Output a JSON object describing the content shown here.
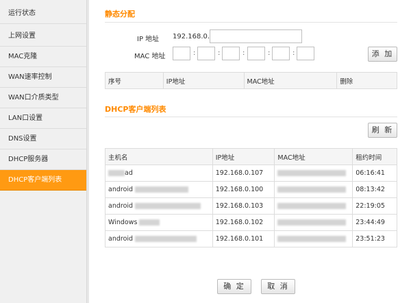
{
  "sidebar": {
    "items": [
      {
        "label": "运行状态"
      },
      {
        "label": "上网设置"
      },
      {
        "label": "MAC克隆"
      },
      {
        "label": "WAN速率控制"
      },
      {
        "label": "WAN口介质类型"
      },
      {
        "label": "LAN口设置"
      },
      {
        "label": "DNS设置"
      },
      {
        "label": "DHCP服务器"
      },
      {
        "label": "DHCP客户端列表"
      }
    ],
    "active_index": 8
  },
  "static": {
    "title": "静态分配",
    "ip_label": "IP 地址",
    "ip_prefix": "192.168.0.",
    "ip_value": "",
    "mac_label": "MAC 地址",
    "mac_sep": ":",
    "add_button": "添 加",
    "table": {
      "headers": [
        "序号",
        "IP地址",
        "MAC地址",
        "删除"
      ]
    }
  },
  "clients": {
    "title": "DHCP客户端列表",
    "refresh_button": "刷 新",
    "headers": [
      "主机名",
      "IP地址",
      "MAC地址",
      "租约时间"
    ],
    "rows": [
      {
        "host": "ad",
        "ip": "192.168.0.107",
        "lease": "06:16:41"
      },
      {
        "host": "android",
        "ip": "192.168.0.100",
        "lease": "08:13:42"
      },
      {
        "host": "android",
        "ip": "192.168.0.103",
        "lease": "22:19:05"
      },
      {
        "host": "Windows",
        "ip": "192.168.0.102",
        "lease": "23:44:49"
      },
      {
        "host": "android",
        "ip": "192.168.0.101",
        "lease": "23:51:23"
      }
    ]
  },
  "footer": {
    "ok_button": "确 定",
    "cancel_button": "取 消"
  },
  "colors": {
    "accent": "#ff8a00",
    "active_bg": "#ff9a12"
  }
}
